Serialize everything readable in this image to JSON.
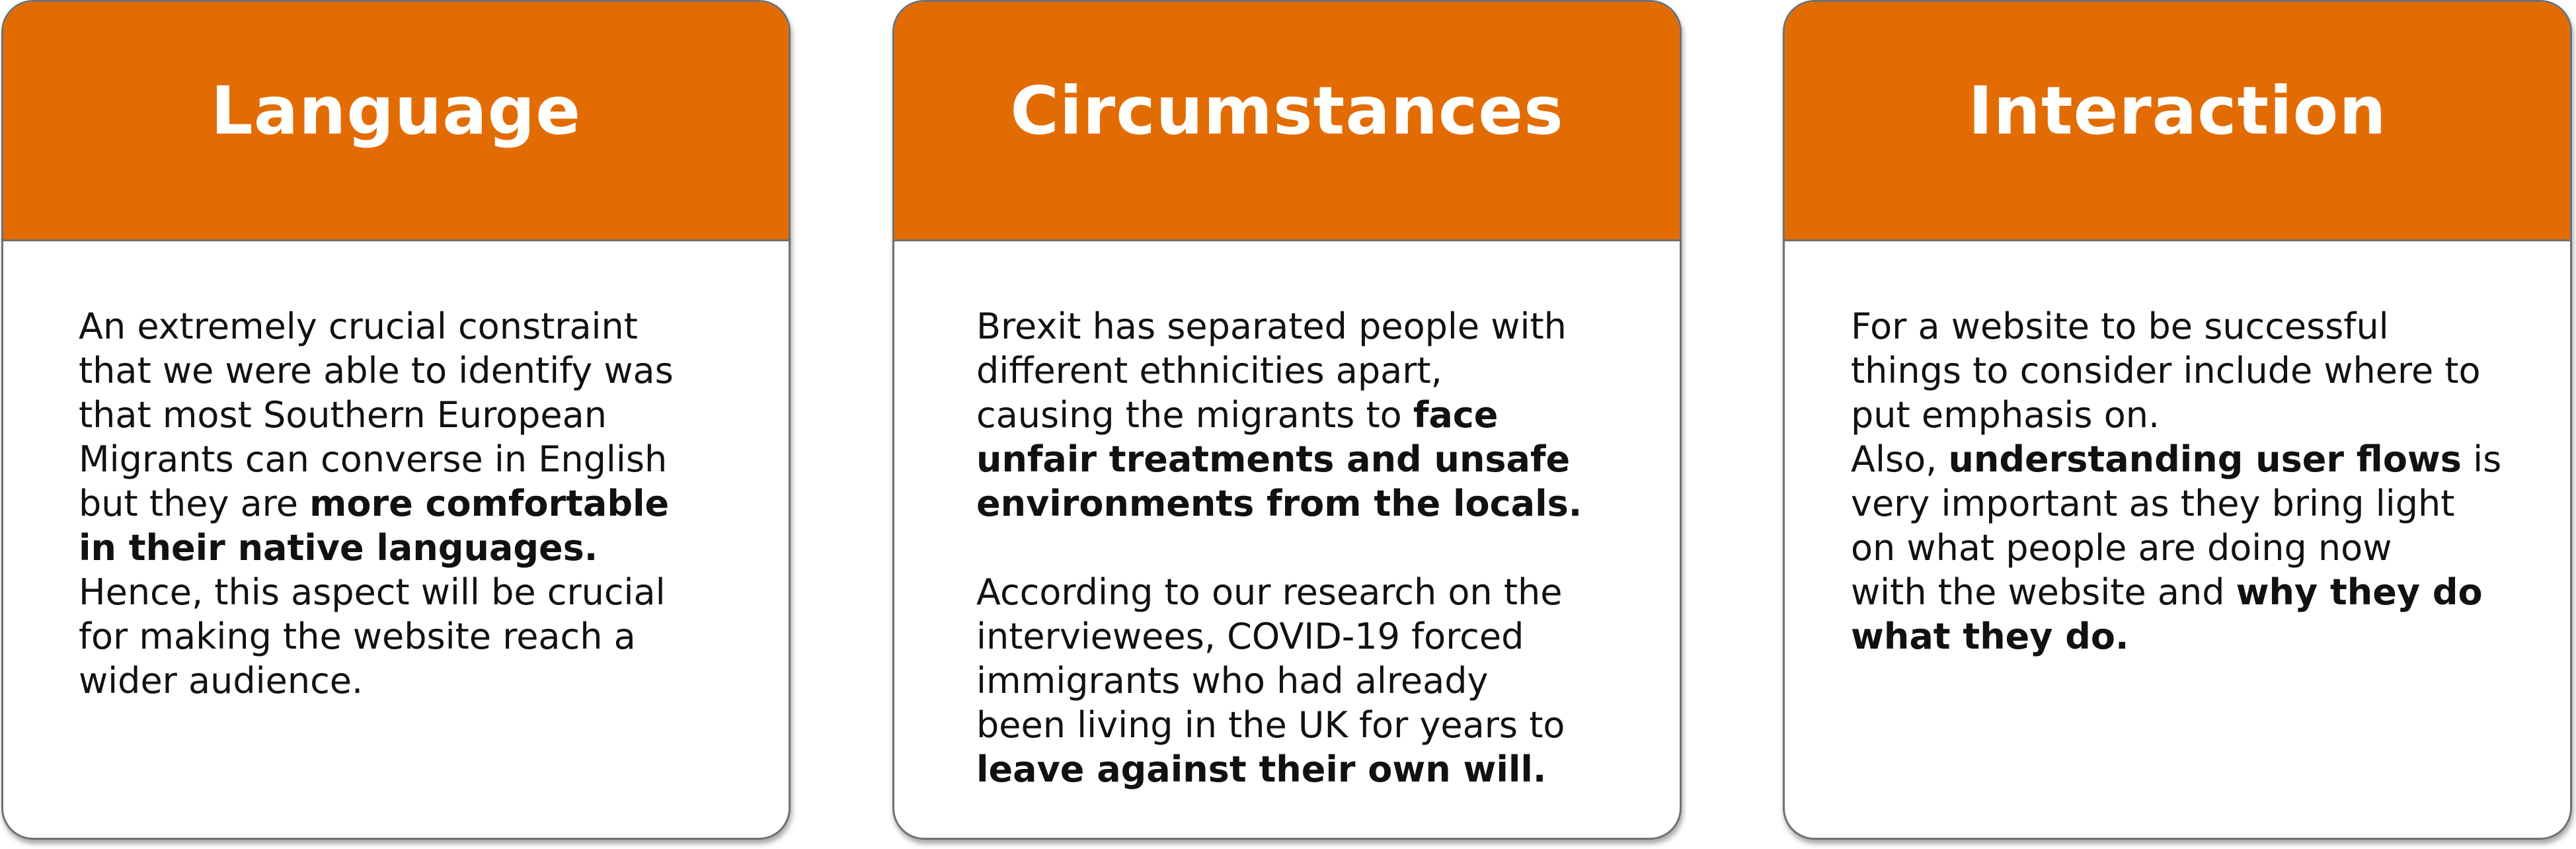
{
  "accent_color": "#e36c02",
  "border_color": "#707070",
  "cards": [
    {
      "title": "Language",
      "paragraphs": [
        [
          {
            "text": "An extremely crucial constraint\nthat we were able to identify was\nthat most Southern European\nMigrants can converse in English\nbut they are ",
            "bold": false
          },
          {
            "text": "more comfortable\nin their native languages.",
            "bold": true
          },
          {
            "text": "\nHence, this aspect will be crucial\nfor making the website reach a\nwider audience.",
            "bold": false
          }
        ]
      ]
    },
    {
      "title": "Circumstances",
      "paragraphs": [
        [
          {
            "text": "Brexit has separated people with\ndifferent ethnicities apart,\ncausing the migrants to ",
            "bold": false
          },
          {
            "text": "face\nunfair treatments and unsafe\nenvironments from the locals.",
            "bold": true
          }
        ],
        [
          {
            "text": "According to our research on the\ninterviewees, COVID-19 forced\nimmigrants who had already\nbeen living in the UK for years to\n",
            "bold": false
          },
          {
            "text": "leave against their own will.",
            "bold": true
          }
        ]
      ]
    },
    {
      "title": "Interaction",
      "paragraphs": [
        [
          {
            "text": "For a website to be successful\nthings to consider include where to\nput emphasis on.\nAlso, ",
            "bold": false
          },
          {
            "text": "understanding user flows",
            "bold": true
          },
          {
            "text": " is\nvery important as they bring light\non what people are doing now\nwith the website and ",
            "bold": false
          },
          {
            "text": "why they do\nwhat they do.",
            "bold": true
          }
        ]
      ]
    }
  ]
}
